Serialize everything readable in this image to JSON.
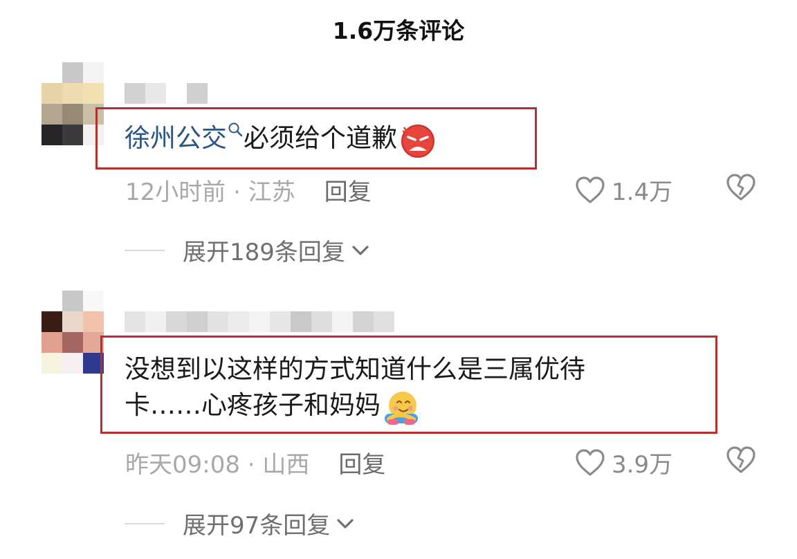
{
  "header": {
    "title": "1.6万条评论"
  },
  "comments": [
    {
      "mention": "徐州公交",
      "text": "必须给个道歉",
      "emoji": "angry-face-emoji",
      "time": "12小时前",
      "location": "江苏",
      "reply_label": "回复",
      "likes": "1.4万",
      "expand_label": "展开189条回复"
    },
    {
      "text_line1": "没想到以这样的方式知道什么是三属优待",
      "text_line2": "卡……心疼孩子和妈妈",
      "emoji": "hugging-face-emoji",
      "time": "昨天09:08",
      "location": "山西",
      "reply_label": "回复",
      "likes": "3.9万",
      "expand_label": "展开97条回复"
    }
  ],
  "colors": {
    "highlight_border": "#b5302c",
    "mention": "#2a5585",
    "meta": "#a8a8a8"
  }
}
